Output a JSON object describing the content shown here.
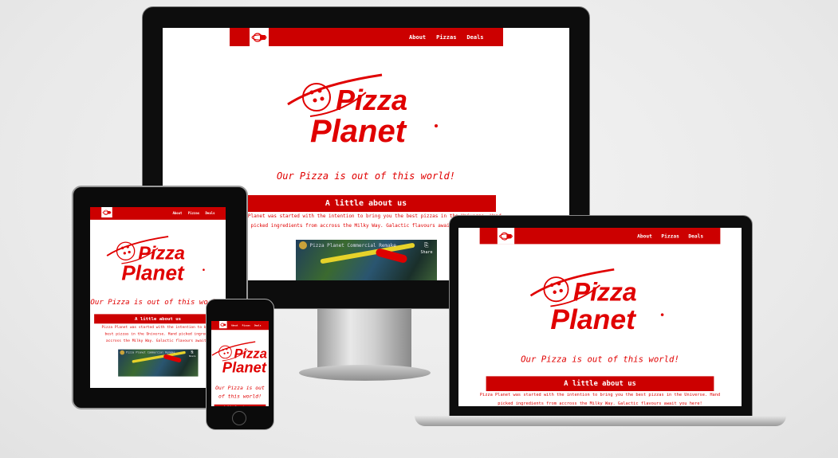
{
  "site": {
    "nav_links": [
      "About",
      "Pizzas",
      "Deals"
    ],
    "logo_text": [
      "Pizza",
      "Planet"
    ],
    "tagline": "Our Pizza is out of this world!",
    "section_title": "A little about us",
    "about_text": "Pizza Planet was started with the intention to bring you the best pizzas in the Universe. Hand picked ingredients from accross the Milky Way. Galactic flavours await you here!",
    "video_title": "Pizza Planet Commercial Remake",
    "video_share_label": "Share"
  },
  "colors": {
    "brand_red": "#cc0000",
    "text_red": "#e00000"
  },
  "devices": [
    "desktop",
    "laptop",
    "tablet",
    "phone"
  ]
}
